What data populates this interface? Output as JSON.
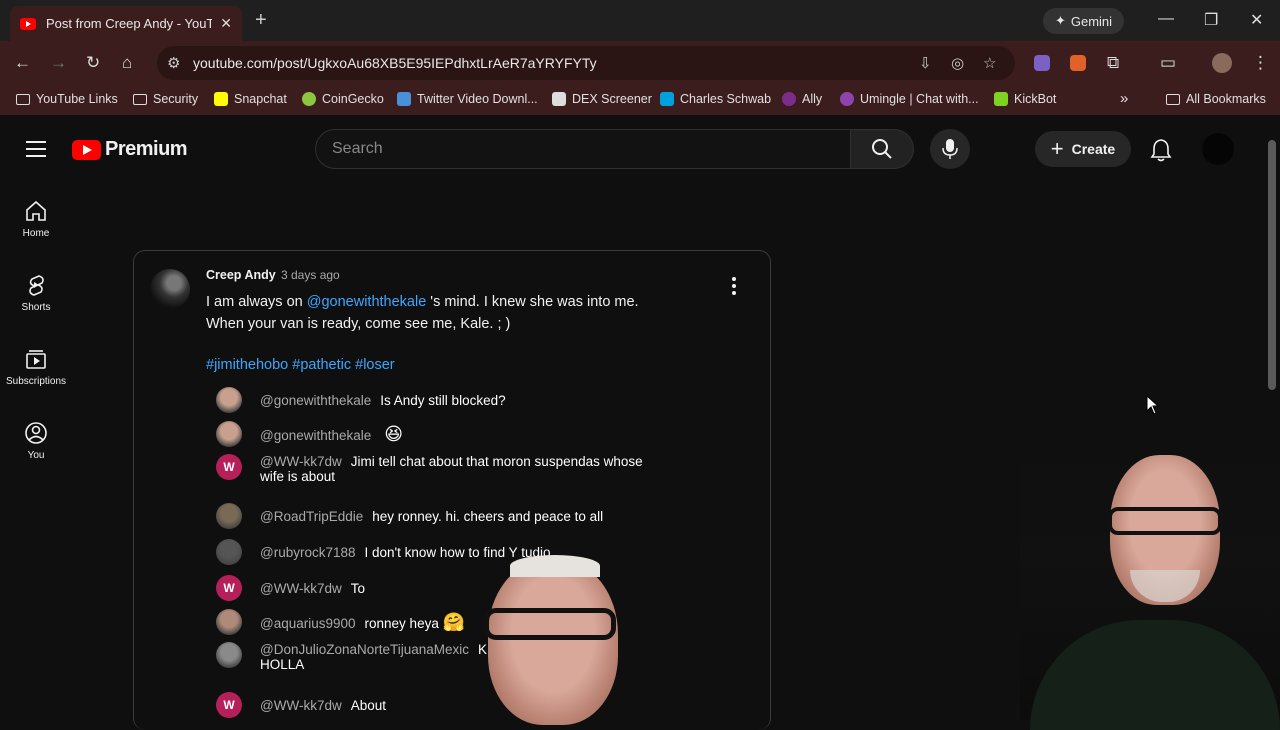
{
  "browser": {
    "tab_title": "Post from Creep Andy - YouTub",
    "new_tab": "+",
    "gemini_label": "Gemini",
    "url": "youtube.com/post/UgkxoAu68XB5E95IEPdhxtLrAeR7aYRYFYTy",
    "bookmarks": [
      "YouTube Links",
      "Security",
      "Snapchat",
      "CoinGecko",
      "Twitter Video Downl...",
      "DEX Screener",
      "Charles Schwab",
      "Ally",
      "Umingle | Chat with...",
      "KickBot"
    ],
    "more_bookmarks": "»",
    "all_bookmarks": "All Bookmarks"
  },
  "youtube": {
    "logo_text": "Premium",
    "search_placeholder": "Search",
    "create_label": "Create",
    "sidebar": [
      {
        "label": "Home",
        "icon": "home-icon"
      },
      {
        "label": "Shorts",
        "icon": "shorts-icon"
      },
      {
        "label": "Subscriptions",
        "icon": "subscriptions-icon"
      },
      {
        "label": "You",
        "icon": "you-icon"
      }
    ]
  },
  "post": {
    "author": "Creep Andy",
    "time": "3 days ago",
    "text_prefix": "I am always on ",
    "mention": "@gonewiththekale",
    "text_suffix": " 's mind. I knew she was into me.",
    "line2": "When your van is ready, come see me, Kale. ; )",
    "tags": "#jimithehobo #pathetic #loser",
    "chat": [
      {
        "user": "@gonewiththekale",
        "msg": "Is Andy still blocked?",
        "avatar": "photo",
        "color": "#c9a08e"
      },
      {
        "user": "@gonewiththekale",
        "msg": "",
        "emoji": "😆",
        "avatar": "photo",
        "color": "#c9a08e"
      },
      {
        "user": "@WW-kk7dw",
        "msg": "Jimi tell chat about that moron suspendas whose",
        "msg2": "wife is about",
        "avatar": "W",
        "color": "#b5205b"
      },
      {
        "user": "@RoadTripEddie",
        "msg": "hey ronney. hi. cheers and peace to all",
        "avatar": "photo",
        "color": "#7a6a55"
      },
      {
        "user": "@rubyrock7188",
        "msg": "I don't know how to find Y  tudio",
        "avatar": "photo",
        "color": "#555"
      },
      {
        "user": "@WW-kk7dw",
        "msg": "To",
        "avatar": "W",
        "color": "#b5205b"
      },
      {
        "user": "@aquarius9900",
        "msg": "ronney heya",
        "emoji": "🤗",
        "avatar": "photo",
        "color": "#b08a78"
      },
      {
        "user": "@DonJulioZonaNorteTijuanaMexic",
        "msg": "KE U",
        "msg2": "HOLLA",
        "avatar": "photo",
        "color": "#8a8a8a"
      },
      {
        "user": "@WW-kk7dw",
        "msg": "About",
        "avatar": "W",
        "color": "#b5205b"
      }
    ]
  }
}
